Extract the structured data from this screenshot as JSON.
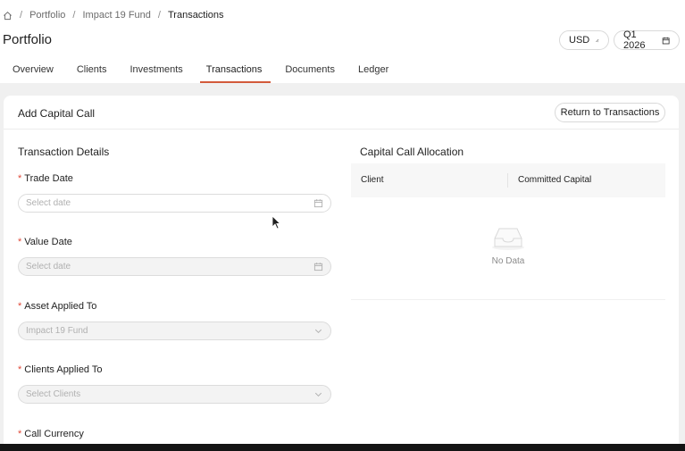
{
  "breadcrumb": {
    "items": [
      "Portfolio",
      "Impact 19 Fund"
    ],
    "current": "Transactions"
  },
  "page": {
    "title": "Portfolio"
  },
  "header": {
    "currency": "USD",
    "period": "Q1 2026"
  },
  "tabs": [
    {
      "label": "Overview"
    },
    {
      "label": "Clients"
    },
    {
      "label": "Investments"
    },
    {
      "label": "Transactions",
      "active": true
    },
    {
      "label": "Documents"
    },
    {
      "label": "Ledger"
    }
  ],
  "card": {
    "title": "Add Capital Call",
    "return_label": "Return to Transactions"
  },
  "details": {
    "title": "Transaction Details",
    "trade_date": {
      "label": "Trade Date",
      "placeholder": "Select date"
    },
    "value_date": {
      "label": "Value Date",
      "placeholder": "Select date"
    },
    "asset": {
      "label": "Asset Applied To",
      "value": "Impact 19 Fund"
    },
    "clients": {
      "label": "Clients Applied To",
      "placeholder": "Select Clients"
    },
    "call_currency": {
      "label": "Call Currency"
    }
  },
  "allocation": {
    "title": "Capital Call Allocation",
    "columns": [
      "Client",
      "Committed Capital"
    ],
    "empty_text": "No Data"
  },
  "colors": {
    "accent": "#d35a3a",
    "required": "#e04a3a"
  }
}
